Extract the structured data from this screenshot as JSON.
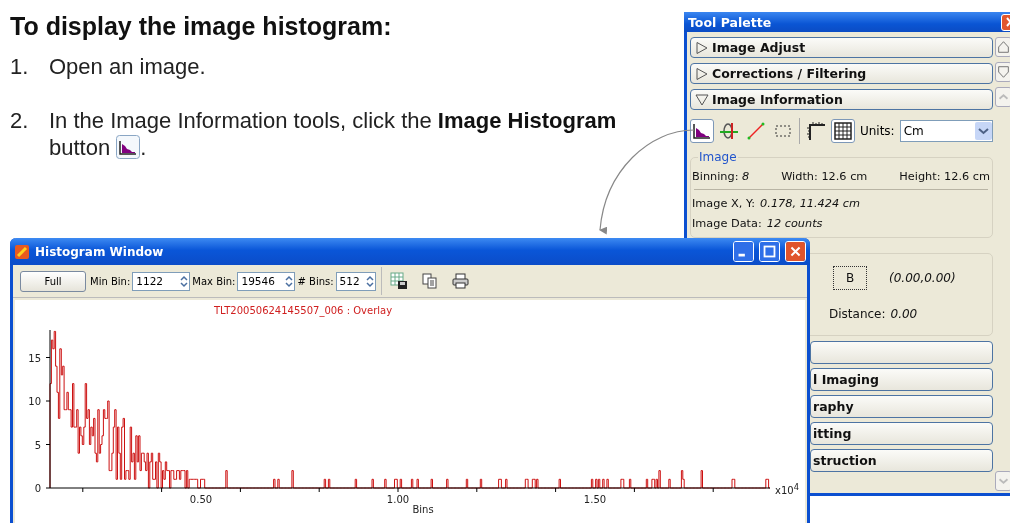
{
  "heading": "To display the image histogram:",
  "steps": [
    {
      "number": "1.",
      "kind": "plain",
      "text": "Open an image."
    },
    {
      "number": "2.",
      "kind": "with-button",
      "text": "In the Image Information tools, click the **Image Histogram** button",
      "trailing": "."
    }
  ],
  "tool_palette": {
    "title": "Tool Palette",
    "sections_top": [
      {
        "label": "Image Adjust",
        "expanded": false
      },
      {
        "label": "Corrections / Filtering",
        "expanded": false
      },
      {
        "label": "Image Information",
        "expanded": true
      }
    ],
    "toolbar": {
      "tools": [
        {
          "kind": "histogram",
          "selected": true
        },
        {
          "kind": "caliper",
          "selected": false
        },
        {
          "kind": "line",
          "selected": false
        },
        {
          "kind": "rectangle",
          "selected": false
        },
        {
          "kind": "ruler",
          "selected": false
        },
        {
          "kind": "grid",
          "selected": true
        }
      ],
      "units_label": "Units:",
      "units_value": "Cm"
    },
    "image_group": {
      "title": "Image",
      "binning_label": "Binning:",
      "binning_value": "8",
      "width": "Width: 12.6 cm",
      "height": "Height: 12.6 cm",
      "xy_label": "Image  X, Y:",
      "xy_value": "0.178, 11.424 cm",
      "data_label": "Image Data:",
      "data_value": "12 counts"
    },
    "measure_group": {
      "marker": "B",
      "coords": "(0.00,0.00)",
      "distance_label": "Distance:",
      "distance_value": "0.00"
    },
    "sections_bottom": [
      {
        "label": "l Imaging"
      },
      {
        "label": "raphy"
      },
      {
        "label": "itting"
      },
      {
        "label": "struction"
      }
    ]
  },
  "histogram_window": {
    "title": "Histogram Window",
    "full_button": "Full",
    "fields": [
      {
        "label": "Min Bin:",
        "value": "1122"
      },
      {
        "label": "Max Bin:",
        "value": "19546"
      },
      {
        "label": "# Bins:",
        "value": "512"
      }
    ],
    "plot": {
      "title": "TLT20050624145507_006 : Overlay",
      "xlabel": "Bins",
      "xticks": [
        "0.50",
        "1.00",
        "1.50"
      ],
      "yticks": [
        "15",
        "10",
        "5",
        "0"
      ],
      "x_multiplier": "x10$^{4}$"
    }
  }
}
